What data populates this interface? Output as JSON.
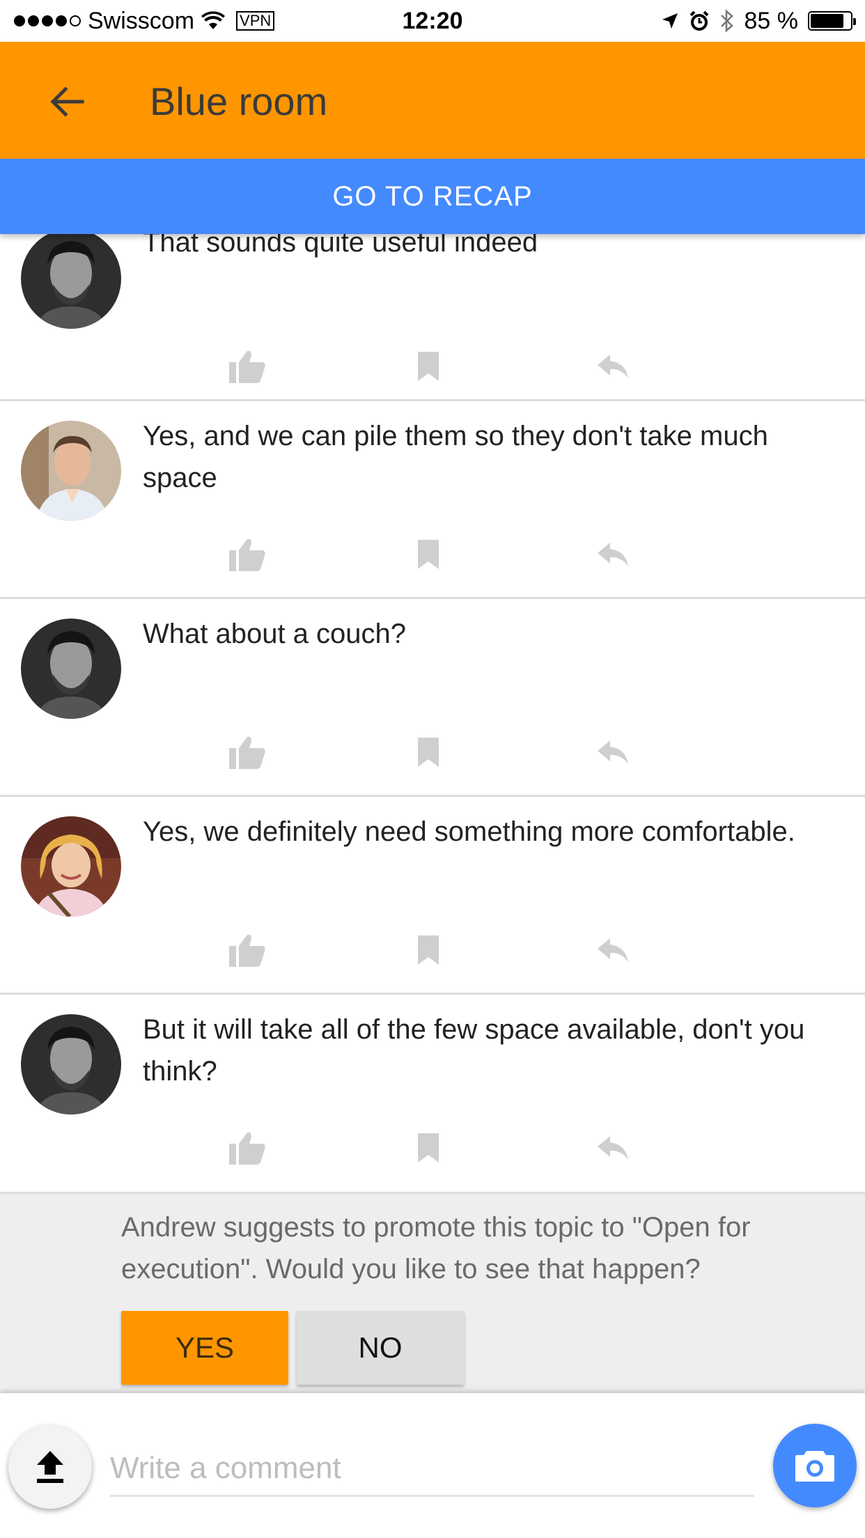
{
  "status_bar": {
    "carrier": "Swisscom",
    "vpn": "VPN",
    "time": "12:20",
    "battery_text": "85 %",
    "battery_level": 0.85
  },
  "header": {
    "title": "Blue room",
    "back_icon": "arrow-back-icon"
  },
  "recap": {
    "label": "GO TO RECAP",
    "color": "#448aff"
  },
  "comments": [
    {
      "author_avatar": "man-beard-bw",
      "text": "That sounds quite useful indeed"
    },
    {
      "author_avatar": "young-man",
      "text": "Yes, and we can pile them so they don't take much space"
    },
    {
      "author_avatar": "man-beard-bw",
      "text": "What about a couch?"
    },
    {
      "author_avatar": "blonde-woman",
      "text": "Yes, we definitely need something more comfortable."
    },
    {
      "author_avatar": "man-beard-bw",
      "text": "But it will take all of the few space available, don't you think?"
    }
  ],
  "actions": {
    "like_icon": "thumb-up-icon",
    "bookmark_icon": "bookmark-icon",
    "reply_icon": "reply-icon"
  },
  "suggestion": {
    "text": "Andrew suggests to promote this topic to \"Open for execution\". Would you like to see that happen?",
    "yes_label": "YES",
    "no_label": "NO"
  },
  "composer": {
    "placeholder": "Write a comment",
    "value": "",
    "upload_icon": "upload-icon",
    "camera_icon": "camera-icon"
  },
  "colors": {
    "accent": "#ff9600",
    "primary": "#448aff"
  }
}
